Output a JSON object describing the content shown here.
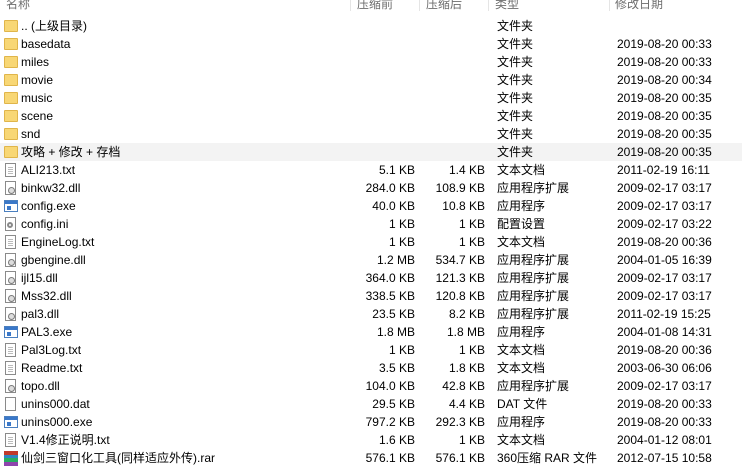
{
  "columns": {
    "name": "名称",
    "size": "压缩前",
    "packed": "压缩后",
    "type": "类型",
    "modified": "修改日期"
  },
  "rows": [
    {
      "name": ".. (上级目录)",
      "size": "",
      "packed": "",
      "type": "文件夹",
      "modified": "",
      "icon": "folder-icon"
    },
    {
      "name": "basedata",
      "size": "",
      "packed": "",
      "type": "文件夹",
      "modified": "2019-08-20 00:33",
      "icon": "folder-icon"
    },
    {
      "name": "miles",
      "size": "",
      "packed": "",
      "type": "文件夹",
      "modified": "2019-08-20 00:33",
      "icon": "folder-icon"
    },
    {
      "name": "movie",
      "size": "",
      "packed": "",
      "type": "文件夹",
      "modified": "2019-08-20 00:34",
      "icon": "folder-icon"
    },
    {
      "name": "music",
      "size": "",
      "packed": "",
      "type": "文件夹",
      "modified": "2019-08-20 00:35",
      "icon": "folder-icon"
    },
    {
      "name": "scene",
      "size": "",
      "packed": "",
      "type": "文件夹",
      "modified": "2019-08-20 00:35",
      "icon": "folder-icon"
    },
    {
      "name": "snd",
      "size": "",
      "packed": "",
      "type": "文件夹",
      "modified": "2019-08-20 00:35",
      "icon": "folder-icon"
    },
    {
      "name": "攻略 + 修改 + 存档",
      "size": "",
      "packed": "",
      "type": "文件夹",
      "modified": "2019-08-20 00:35",
      "icon": "folder-icon"
    },
    {
      "name": "ALI213.txt",
      "size": "5.1 KB",
      "packed": "1.4 KB",
      "type": "文本文档",
      "modified": "2011-02-19 16:11",
      "icon": "text-file-icon"
    },
    {
      "name": "binkw32.dll",
      "size": "284.0 KB",
      "packed": "108.9 KB",
      "type": "应用程序扩展",
      "modified": "2009-02-17 03:17",
      "icon": "dll-file-icon"
    },
    {
      "name": "config.exe",
      "size": "40.0 KB",
      "packed": "10.8 KB",
      "type": "应用程序",
      "modified": "2009-02-17 03:17",
      "icon": "exe-file-icon"
    },
    {
      "name": "config.ini",
      "size": "1 KB",
      "packed": "1 KB",
      "type": "配置设置",
      "modified": "2009-02-17 03:22",
      "icon": "ini-file-icon"
    },
    {
      "name": "EngineLog.txt",
      "size": "1 KB",
      "packed": "1 KB",
      "type": "文本文档",
      "modified": "2019-08-20 00:36",
      "icon": "text-file-icon"
    },
    {
      "name": "gbengine.dll",
      "size": "1.2 MB",
      "packed": "534.7 KB",
      "type": "应用程序扩展",
      "modified": "2004-01-05 16:39",
      "icon": "dll-file-icon"
    },
    {
      "name": "ijl15.dll",
      "size": "364.0 KB",
      "packed": "121.3 KB",
      "type": "应用程序扩展",
      "modified": "2009-02-17 03:17",
      "icon": "dll-file-icon"
    },
    {
      "name": "Mss32.dll",
      "size": "338.5 KB",
      "packed": "120.8 KB",
      "type": "应用程序扩展",
      "modified": "2009-02-17 03:17",
      "icon": "dll-file-icon"
    },
    {
      "name": "pal3.dll",
      "size": "23.5 KB",
      "packed": "8.2 KB",
      "type": "应用程序扩展",
      "modified": "2011-02-19 15:25",
      "icon": "dll-file-icon"
    },
    {
      "name": "PAL3.exe",
      "size": "1.8 MB",
      "packed": "1.8 MB",
      "type": "应用程序",
      "modified": "2004-01-08 14:31",
      "icon": "exe-file-icon"
    },
    {
      "name": "Pal3Log.txt",
      "size": "1 KB",
      "packed": "1 KB",
      "type": "文本文档",
      "modified": "2019-08-20 00:36",
      "icon": "text-file-icon"
    },
    {
      "name": "Readme.txt",
      "size": "3.5 KB",
      "packed": "1.8 KB",
      "type": "文本文档",
      "modified": "2003-06-30 06:06",
      "icon": "text-file-icon"
    },
    {
      "name": "topo.dll",
      "size": "104.0 KB",
      "packed": "42.8 KB",
      "type": "应用程序扩展",
      "modified": "2009-02-17 03:17",
      "icon": "dll-file-icon"
    },
    {
      "name": "unins000.dat",
      "size": "29.5 KB",
      "packed": "4.4 KB",
      "type": "DAT 文件",
      "modified": "2019-08-20 00:33",
      "icon": "dat-file-icon"
    },
    {
      "name": "unins000.exe",
      "size": "797.2 KB",
      "packed": "292.3 KB",
      "type": "应用程序",
      "modified": "2019-08-20 00:33",
      "icon": "exe-file-icon"
    },
    {
      "name": "V1.4修正说明.txt",
      "size": "1.6 KB",
      "packed": "1 KB",
      "type": "文本文档",
      "modified": "2004-01-12 08:01",
      "icon": "text-file-icon"
    },
    {
      "name": "仙剑三窗口化工具(同样适应外传).rar",
      "size": "576.1 KB",
      "packed": "576.1 KB",
      "type": "360压缩 RAR 文件",
      "modified": "2012-07-15 10:58",
      "icon": "rar-archive-icon"
    }
  ],
  "hover_row": 7,
  "colors": {
    "folder": "#f8d775",
    "hover_background": "#f3f3f3",
    "header_text": "#6d6d6d",
    "exe_accent": "#3a78c9"
  }
}
